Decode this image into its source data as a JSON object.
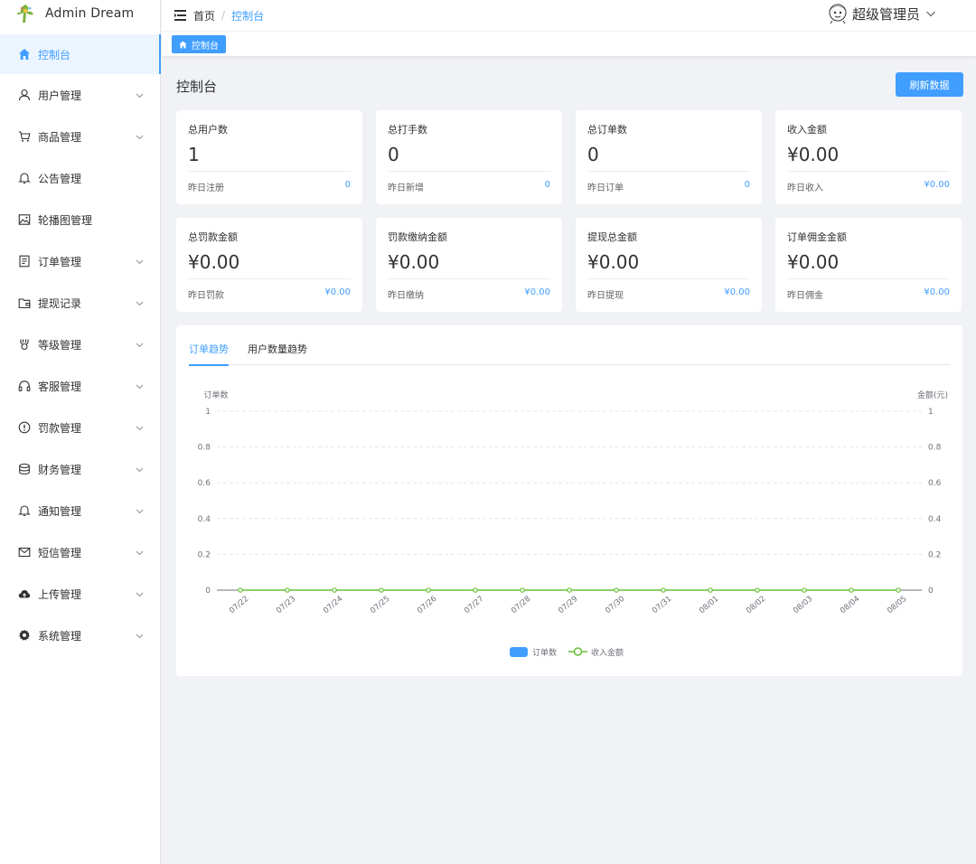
{
  "app": {
    "title": "Admin Dream"
  },
  "sidebar": {
    "items": [
      {
        "label": "控制台",
        "icon": "home-icon",
        "active": true,
        "expandable": false
      },
      {
        "label": "用户管理",
        "icon": "user-icon",
        "expandable": true
      },
      {
        "label": "商品管理",
        "icon": "cart-icon",
        "expandable": true
      },
      {
        "label": "公告管理",
        "icon": "bell-icon",
        "expandable": false
      },
      {
        "label": "轮播图管理",
        "icon": "picture-icon",
        "expandable": false
      },
      {
        "label": "订单管理",
        "icon": "document-icon",
        "expandable": true
      },
      {
        "label": "提现记录",
        "icon": "wallet-icon",
        "expandable": true
      },
      {
        "label": "等级管理",
        "icon": "medal-icon",
        "expandable": true
      },
      {
        "label": "客服管理",
        "icon": "headset-icon",
        "expandable": true
      },
      {
        "label": "罚款管理",
        "icon": "warning-icon",
        "expandable": true
      },
      {
        "label": "财务管理",
        "icon": "coins-icon",
        "expandable": true
      },
      {
        "label": "通知管理",
        "icon": "bell-icon",
        "expandable": true
      },
      {
        "label": "短信管理",
        "icon": "message-icon",
        "expandable": true
      },
      {
        "label": "上传管理",
        "icon": "upload-cloud-icon",
        "expandable": true
      },
      {
        "label": "系统管理",
        "icon": "gear-icon",
        "expandable": true
      }
    ]
  },
  "header": {
    "breadcrumb_home": "首页",
    "breadcrumb_sep": "/",
    "breadcrumb_current": "控制台",
    "user_name": "超级管理员"
  },
  "tagsbar": {
    "active_tag": "控制台"
  },
  "page": {
    "title": "控制台",
    "refresh_label": "刷新数据"
  },
  "stats": [
    {
      "title": "总用户数",
      "value": "1",
      "sub_label": "昨日注册",
      "sub_value": "0"
    },
    {
      "title": "总打手数",
      "value": "0",
      "sub_label": "昨日新增",
      "sub_value": "0"
    },
    {
      "title": "总订单数",
      "value": "0",
      "sub_label": "昨日订单",
      "sub_value": "0"
    },
    {
      "title": "收入金额",
      "value": "¥0.00",
      "sub_label": "昨日收入",
      "sub_value": "¥0.00"
    },
    {
      "title": "总罚款金额",
      "value": "¥0.00",
      "sub_label": "昨日罚款",
      "sub_value": "¥0.00"
    },
    {
      "title": "罚款缴纳金额",
      "value": "¥0.00",
      "sub_label": "昨日缴纳",
      "sub_value": "¥0.00"
    },
    {
      "title": "提现总金额",
      "value": "¥0.00",
      "sub_label": "昨日提现",
      "sub_value": "¥0.00"
    },
    {
      "title": "订单佣金金额",
      "value": "¥0.00",
      "sub_label": "昨日佣金",
      "sub_value": "¥0.00"
    }
  ],
  "chart_tabs": [
    {
      "label": "订单趋势",
      "active": true
    },
    {
      "label": "用户数量趋势",
      "active": false
    }
  ],
  "colors": {
    "accent": "#409eff",
    "bar_series": "#409eff",
    "line_series": "#67c23a",
    "grid": "#e0e6f1"
  },
  "chart_data": {
    "type": "bar",
    "categories": [
      "07/22",
      "07/23",
      "07/24",
      "07/25",
      "07/26",
      "07/27",
      "07/28",
      "07/29",
      "07/30",
      "07/31",
      "08/01",
      "08/02",
      "08/03",
      "08/04",
      "08/05"
    ],
    "series": [
      {
        "name": "订单数",
        "type": "bar",
        "axis": "left",
        "values": [
          0,
          0,
          0,
          0,
          0,
          0,
          0,
          0,
          0,
          0,
          0,
          0,
          0,
          0,
          0
        ]
      },
      {
        "name": "收入金额",
        "type": "line",
        "axis": "right",
        "values": [
          0,
          0,
          0,
          0,
          0,
          0,
          0,
          0,
          0,
          0,
          0,
          0,
          0,
          0,
          0
        ]
      }
    ],
    "ylabel_left": "订单数",
    "ylabel_right": "金额(元)",
    "ylim_left": [
      0,
      1
    ],
    "ylim_right": [
      0,
      1
    ],
    "yticks": [
      "0",
      "0.2",
      "0.4",
      "0.6",
      "0.8",
      "1"
    ],
    "grid": true,
    "legend_position": "bottom-center"
  }
}
